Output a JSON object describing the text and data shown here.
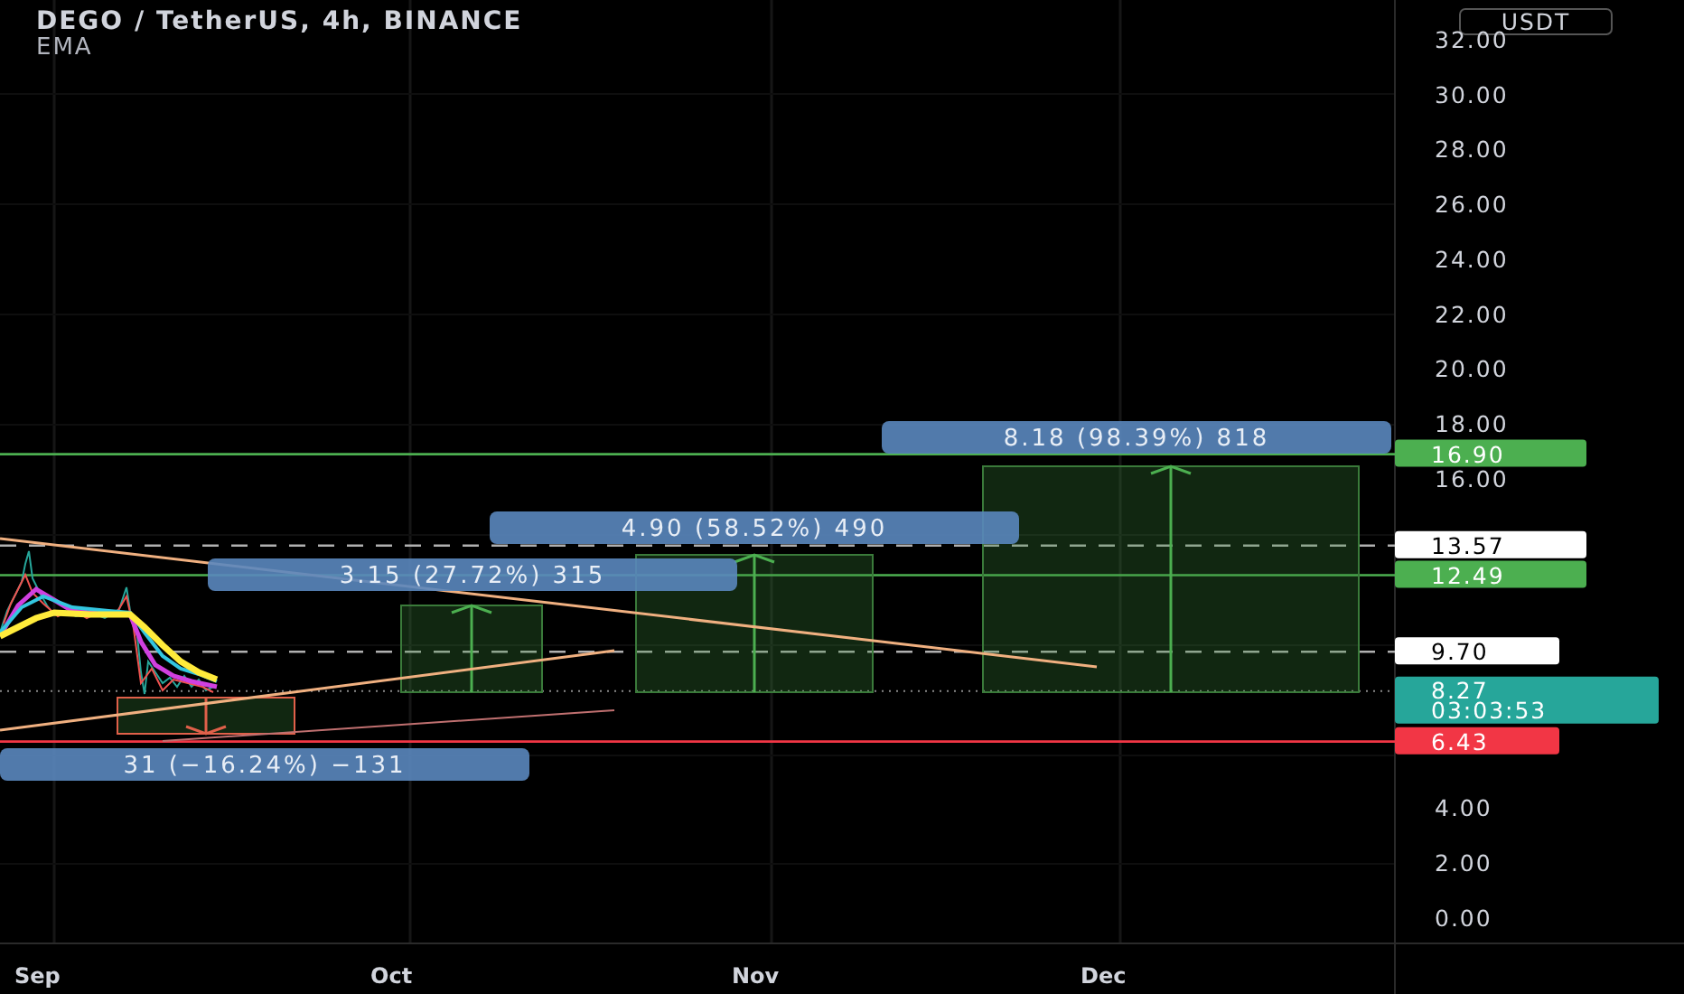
{
  "header": {
    "title": "DEGO / TetherUS, 4h, BINANCE",
    "indicator": "EMA"
  },
  "price_axis": {
    "currency": "USDT",
    "ticks": [
      "32.00",
      "30.00",
      "28.00",
      "26.00",
      "24.00",
      "22.00",
      "20.00",
      "18.00",
      "16.00",
      "4.00",
      "2.00",
      "0.00"
    ]
  },
  "levels": [
    {
      "label": "16.90",
      "color": "#4caf50",
      "kind": "solid"
    },
    {
      "label": "13.57",
      "color": "#ffffff",
      "kind": "dashed"
    },
    {
      "label": "12.49",
      "color": "#4caf50",
      "kind": "solid"
    },
    {
      "label": "9.70",
      "color": "#ffffff",
      "kind": "dashed"
    },
    {
      "label": "8.27",
      "countdown": "03:03:53",
      "color": "#26a69a",
      "kind": "current"
    },
    {
      "label": "6.43",
      "color": "#f23645",
      "kind": "solid"
    }
  ],
  "measurements": [
    {
      "label": "8.18 (98.39%) 818",
      "kind": "up"
    },
    {
      "label": "4.90 (58.52%) 490",
      "kind": "up"
    },
    {
      "label": "3.15 (27.72%) 315",
      "kind": "up"
    },
    {
      "label": "31 (−16.24%) −131",
      "kind": "down"
    }
  ],
  "time_axis": [
    "Sep",
    "Oct",
    "Nov",
    "Dec"
  ]
}
